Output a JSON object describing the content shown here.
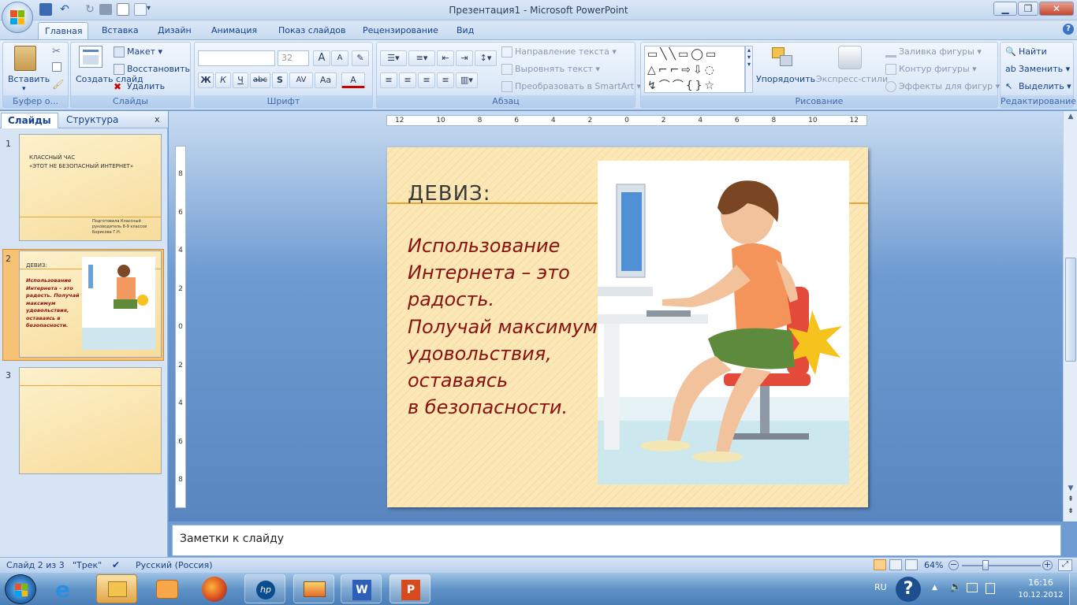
{
  "window": {
    "title": "Презентация1 - Microsoft PowerPoint",
    "minimize": "▁",
    "restore": "❐",
    "close": "✕",
    "help": "?"
  },
  "ribbon_tabs": [
    "Главная",
    "Вставка",
    "Дизайн",
    "Анимация",
    "Показ слайдов",
    "Рецензирование",
    "Вид"
  ],
  "active_tab": "Главная",
  "groups": {
    "clipboard": {
      "label": "Буфер о...",
      "paste": "Вставить"
    },
    "slides": {
      "label": "Слайды",
      "new_slide": "Создать слайд",
      "layout": "Макет",
      "reset": "Восстановить",
      "delete": "Удалить"
    },
    "font": {
      "label": "Шрифт",
      "font_name": "",
      "font_size": "32",
      "bold": "Ж",
      "italic": "К",
      "underline": "Ч",
      "strike": "abc",
      "shadow": "S",
      "spacing": "AV",
      "case": "Aa",
      "color": "A",
      "grow": "A",
      "shrink": "A"
    },
    "paragraph": {
      "label": "Абзац",
      "text_direction": "Направление текста",
      "align_text": "Выровнять текст",
      "smartart": "Преобразовать в SmartArt"
    },
    "drawing": {
      "label": "Рисование",
      "arrange": "Упорядочить",
      "quick_styles": "Экспресс-стили",
      "shape_fill": "Заливка фигуры",
      "shape_outline": "Контур фигуры",
      "shape_effects": "Эффекты для фигур"
    },
    "editing": {
      "label": "Редактирование",
      "find": "Найти",
      "replace": "Заменить",
      "select": "Выделить"
    }
  },
  "panel": {
    "tab_slides": "Слайды",
    "tab_outline": "Структура",
    "close": "x"
  },
  "thumbnails": [
    {
      "num": "1",
      "title": "КЛАССНЫЙ ЧАС\n«ЭТОТ НЕ БЕЗОПАСНЫЙ ИНТЕРНЕТ»",
      "subtitle": "Подготовила Классный руководитель 8-9 классов Борисова Г.Н."
    },
    {
      "num": "2",
      "title": "ДЕВИЗ:",
      "body": "Использование Интернета – это радость. Получай максимум удовольствия, оставаясь в безопасности."
    },
    {
      "num": "3"
    }
  ],
  "ruler": {
    "h_labels": [
      "12",
      "10",
      "8",
      "6",
      "4",
      "2",
      "0",
      "2",
      "4",
      "6",
      "8",
      "10",
      "12"
    ],
    "v_labels": [
      "8",
      "6",
      "4",
      "2",
      "0",
      "2",
      "4",
      "6",
      "8"
    ]
  },
  "slide": {
    "title": "ДЕВИЗ:",
    "para1_lines": [
      "Использование",
      "Интернета – это",
      "радость."
    ],
    "para2_lines": [
      "Получай максимум",
      "удовольствия,",
      "оставаясь",
      "в безопасности."
    ]
  },
  "notes_placeholder": "Заметки к слайду",
  "status": {
    "slide": "Слайд 2 из 3",
    "theme": "\"Трек\"",
    "language": "Русский (Россия)",
    "zoom": "64%",
    "zoom_level_percent": 64
  },
  "taskbar": {
    "lang": "RU",
    "time": "16:16",
    "date": "10.12.2012"
  },
  "colors": {
    "slide_text": "#8b1010",
    "accent_line": "#e8a33a",
    "selection": "#f5b55a"
  }
}
